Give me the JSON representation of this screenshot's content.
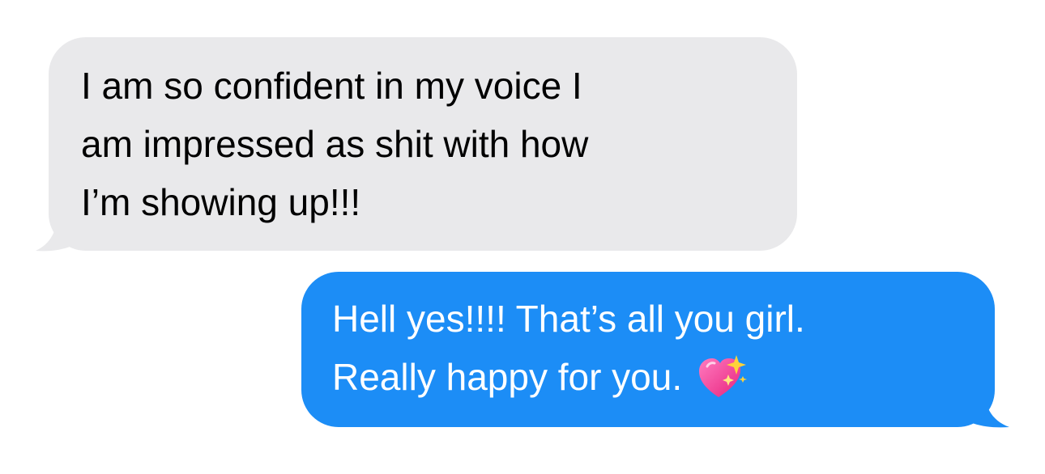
{
  "messages": [
    {
      "direction": "incoming",
      "lines": [
        "I am so confident in my voice I",
        "am impressed as shit with how",
        "I’m showing up!!!"
      ]
    },
    {
      "direction": "outgoing",
      "lines": [
        "Hell yes!!!! That’s all you girl.",
        "Really happy for you."
      ],
      "emoji": "sparkling-heart-icon"
    }
  ],
  "colors": {
    "incoming_bubble": "#e9e9eb",
    "incoming_text": "#000000",
    "outgoing_bubble": "#1c8df6",
    "outgoing_text": "#ffffff",
    "heart": "#f23d8f",
    "sparkle": "#ffd23a"
  }
}
